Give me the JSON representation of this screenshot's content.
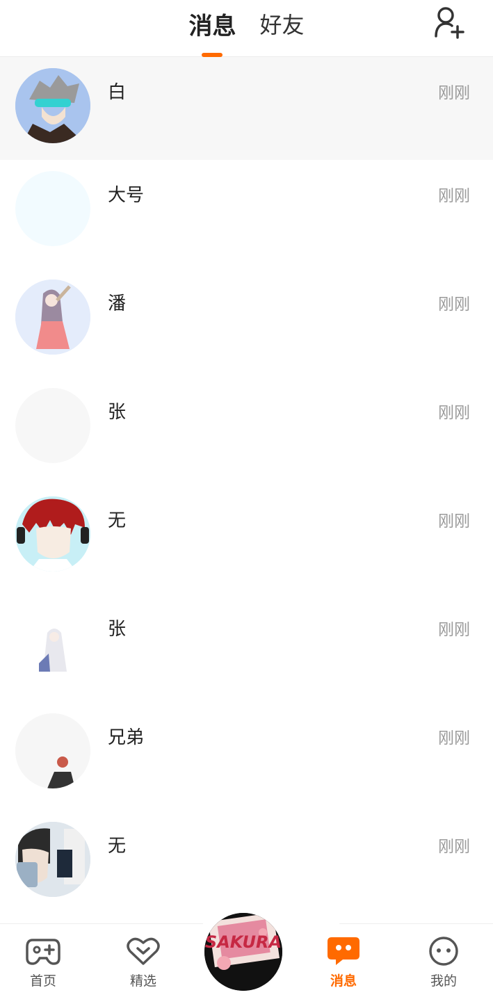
{
  "header": {
    "tabs": [
      {
        "label": "消息",
        "active": true
      },
      {
        "label": "好友",
        "active": false
      }
    ],
    "add_friend_icon": "person-add-icon"
  },
  "conversations": [
    {
      "name": "白",
      "time": "刚刚",
      "avatar_color": "#a9c4ee"
    },
    {
      "name": "大号",
      "time": "刚刚",
      "avatar_color": "#f2fbff"
    },
    {
      "name": "潘",
      "time": "刚刚",
      "avatar_color": "#dfe8fb"
    },
    {
      "name": "张",
      "time": "刚刚",
      "avatar_color": "#f7f7f7"
    },
    {
      "name": "无",
      "time": "刚刚",
      "avatar_color": "#c8eff6"
    },
    {
      "name": "张",
      "time": "刚刚",
      "avatar_color": "#ffffff"
    },
    {
      "name": "兄弟",
      "time": "刚刚",
      "avatar_color": "#f6f6f6"
    },
    {
      "name": "无",
      "time": "刚刚",
      "avatar_color": "#cfd8e0"
    }
  ],
  "bottom_nav": {
    "items": [
      {
        "label": "首页",
        "icon": "gamepad-icon"
      },
      {
        "label": "精选",
        "icon": "heart-chevron-icon"
      },
      {
        "label": "消息",
        "icon": "chat-bubble-icon",
        "active": true
      },
      {
        "label": "我的",
        "icon": "face-icon"
      }
    ],
    "center_text": "SAKURA"
  },
  "colors": {
    "accent": "#ff6a00",
    "time_text": "#9a9a9a"
  }
}
